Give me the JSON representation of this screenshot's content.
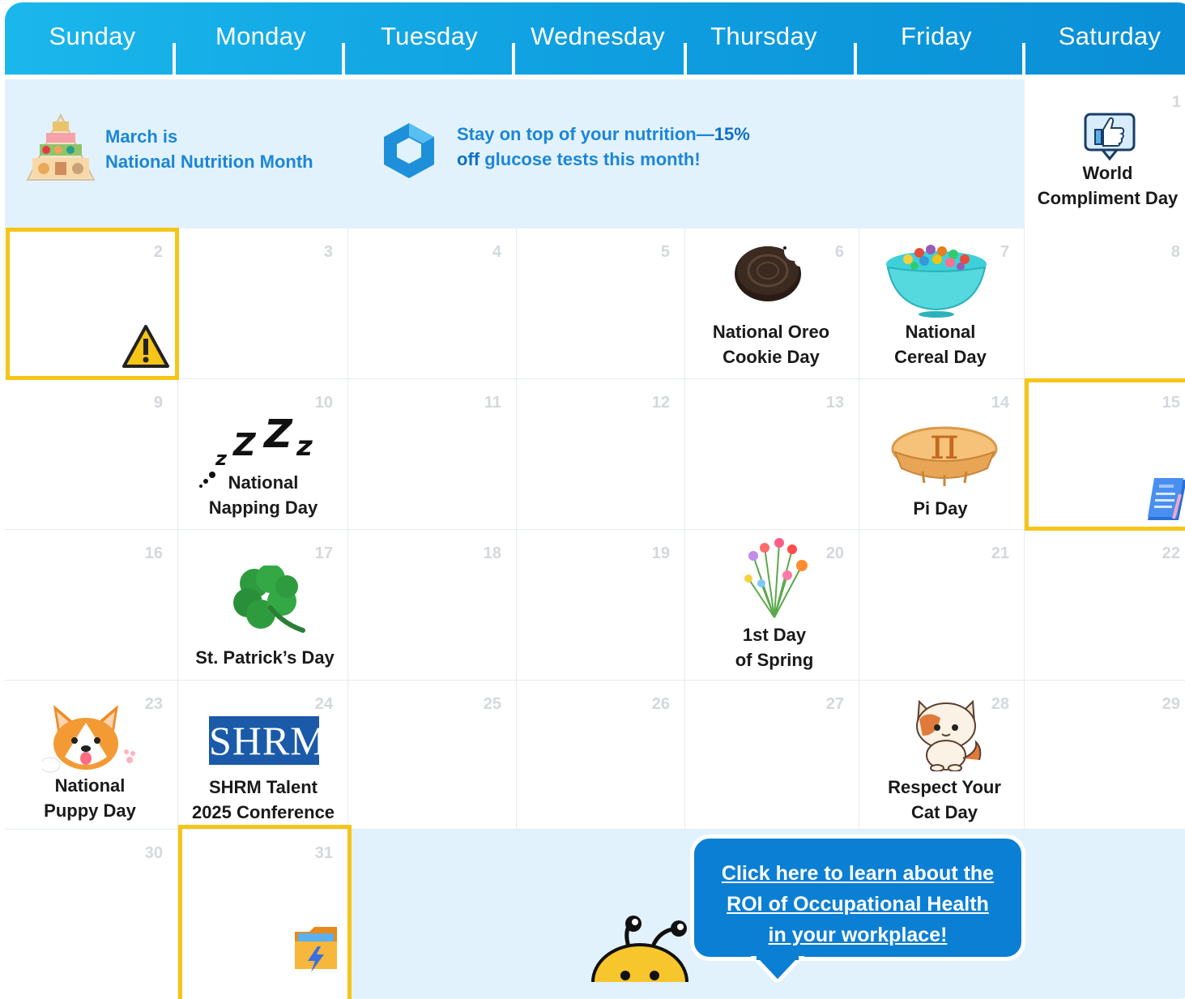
{
  "header": {
    "days": [
      "Sunday",
      "Monday",
      "Tuesday",
      "Wednesday",
      "Thursday",
      "Friday",
      "Saturday"
    ]
  },
  "banner": {
    "nutrition_line1": "March is",
    "nutrition_line2": "National Nutrition Month",
    "promo_line1a": "Stay on top of your nutrition—",
    "promo_line1b": "15%",
    "promo_line2a": "off",
    "promo_line2b": " glucose tests this month!"
  },
  "days": {
    "d1": {
      "num": "1",
      "line1": "World",
      "line2": "Compliment Day"
    },
    "d2": {
      "num": "2"
    },
    "d3": {
      "num": "3"
    },
    "d4": {
      "num": "4"
    },
    "d5": {
      "num": "5"
    },
    "d6": {
      "num": "6",
      "line1": "National Oreo",
      "line2": "Cookie Day"
    },
    "d7": {
      "num": "7",
      "line1": "National",
      "line2": "Cereal Day"
    },
    "d8": {
      "num": "8"
    },
    "d9": {
      "num": "9"
    },
    "d10": {
      "num": "10",
      "line1": "National",
      "line2": "Napping Day",
      "zzz": "zZZz"
    },
    "d11": {
      "num": "11"
    },
    "d12": {
      "num": "12"
    },
    "d13": {
      "num": "13"
    },
    "d14": {
      "num": "14",
      "line1": "Pi Day",
      "pi": "π"
    },
    "d15": {
      "num": "15"
    },
    "d16": {
      "num": "16"
    },
    "d17": {
      "num": "17",
      "line1": "St. Patrick’s Day"
    },
    "d18": {
      "num": "18"
    },
    "d19": {
      "num": "19"
    },
    "d20": {
      "num": "20",
      "line1": "1st Day",
      "line2": "of Spring"
    },
    "d21": {
      "num": "21"
    },
    "d22": {
      "num": "22"
    },
    "d23": {
      "num": "23",
      "line1": "National",
      "line2": "Puppy Day"
    },
    "d24": {
      "num": "24",
      "line1": "SHRM Talent",
      "line2": "2025 Conference",
      "logo": "SHRM"
    },
    "d25": {
      "num": "25"
    },
    "d26": {
      "num": "26"
    },
    "d27": {
      "num": "27"
    },
    "d28": {
      "num": "28",
      "line1": "Respect Your",
      "line2": "Cat Day"
    },
    "d29": {
      "num": "29"
    },
    "d30": {
      "num": "30"
    },
    "d31": {
      "num": "31"
    }
  },
  "cta": {
    "line1": "Click here to learn about the",
    "line2": "ROI of Occupational Health",
    "line3": "in your workplace!"
  },
  "colors": {
    "header": "#0f9fe0",
    "highlight": "#f5c518",
    "band": "#e2f2fc",
    "cta": "#0b7fd3"
  },
  "icons": [
    "food-pyramid-icon",
    "hexagon-logo-icon",
    "thumbs-up-icon",
    "warning-icon",
    "oreo-cookie-icon",
    "cereal-bowl-icon",
    "zzz-icon",
    "pie-icon",
    "form-document-icon",
    "shamrock-icon",
    "flower-bouquet-icon",
    "corgi-icon",
    "shrm-logo",
    "cat-icon",
    "folder-lightning-icon",
    "bee-mascot-icon"
  ]
}
